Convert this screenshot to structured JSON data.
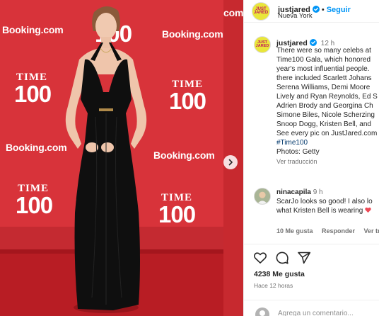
{
  "photo": {
    "wall_logos": {
      "booking": "Booking.com",
      "booking_partial": "com",
      "time_word": "TIME",
      "time_number": "100",
      "time_partial": "E"
    }
  },
  "post": {
    "author": {
      "username": "justjared",
      "avatar_logo": "JUST\nJARED",
      "verified": true,
      "location": "Nueva York"
    },
    "header": {
      "separator": "•",
      "follow_label": "Seguir"
    },
    "caption": {
      "username": "justjared",
      "time_ago": "12 h",
      "lines": [
        "There were so many celebs at",
        "Time100 Gala, which honored",
        "year's most influential people.",
        "there included Scarlett Johans",
        "Serena Williams, Demi Moore",
        "Lively and Ryan Reynolds, Ed S",
        "Adrien Brody and Georgina Ch",
        "Simone Biles, Nicole Scherzing",
        "Snoop Dogg, Kristen Bell, and",
        "See every pic on JustJared.com"
      ],
      "hashtag": "#Time100",
      "photo_credit": "Photos: Getty",
      "translate_label": "Ver traducción"
    },
    "comment": {
      "username": "ninacapila",
      "time_ago": "9 h",
      "text_line1": "ScarJo looks so good! I also lo",
      "text_line2": "what Kristen Bell is wearing",
      "likes_label": "10 Me gusta",
      "reply_label": "Responder",
      "translate_partial": "Ver tra"
    },
    "actions": {
      "likes": "4238 Me gusta",
      "posted_ago": "Hace 12 horas"
    },
    "add_comment_placeholder": "Agrega un comentario..."
  },
  "colors": {
    "backdrop_red": "#d8333a",
    "carpet_red": "#b81d24",
    "link_blue": "#0095f6",
    "verified_blue": "#0095f6",
    "heart_red": "#ed4956",
    "avatar_yellow": "#e9e63a",
    "logo_magenta": "#c2185b"
  },
  "icons": {
    "verified": "verified-badge-icon",
    "next": "chevron-right-icon",
    "like": "heart-icon",
    "comment": "comment-bubble-icon",
    "share": "paper-plane-icon",
    "comment_like": "heart-icon"
  }
}
